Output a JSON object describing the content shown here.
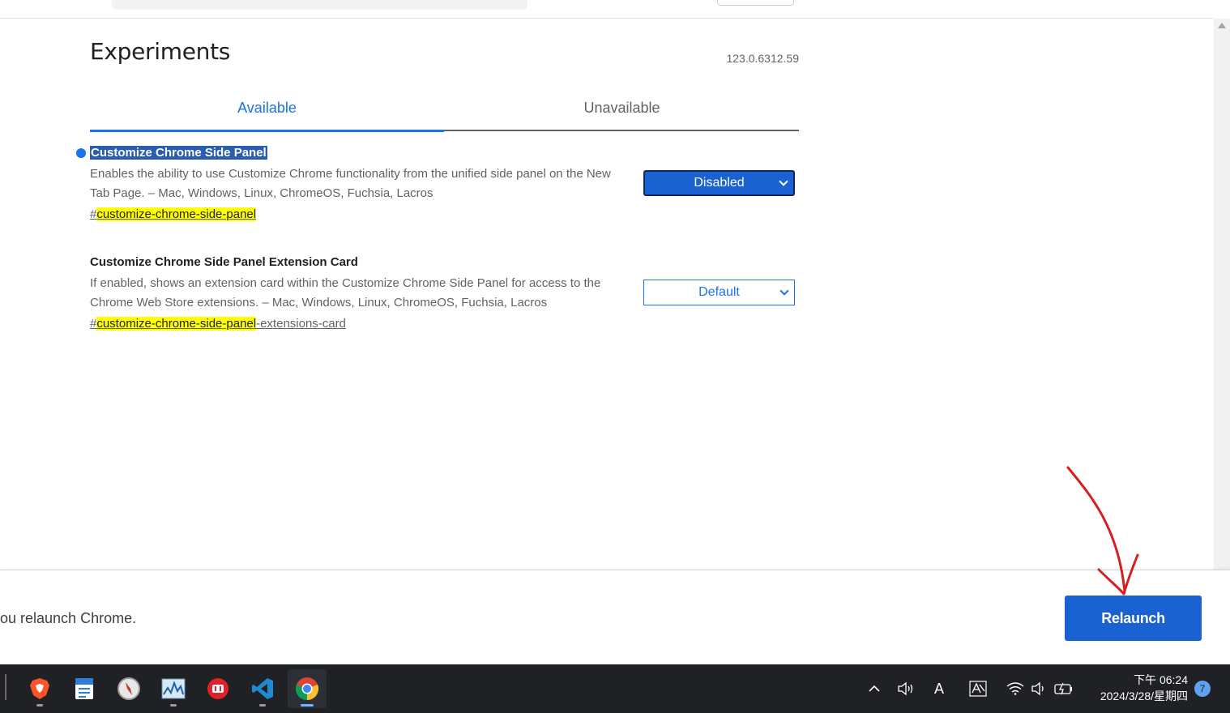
{
  "page": {
    "title": "Experiments",
    "version": "123.0.6312.59"
  },
  "tabs": [
    {
      "label": "Available",
      "active": true
    },
    {
      "label": "Unavailable",
      "active": false
    }
  ],
  "experiments": [
    {
      "title": "Customize Chrome Side Panel",
      "description": "Enables the ability to use Customize Chrome functionality from the unified side panel on the New Tab Page. – Mac, Windows, Linux, ChromeOS, Fuchsia, Lacros",
      "link_prefix": "#",
      "link_match": "customize-chrome-side-panel",
      "link_suffix": "",
      "select_value": "Disabled",
      "modified": true
    },
    {
      "title": "Customize Chrome Side Panel Extension Card",
      "description": "If enabled, shows an extension card within the Customize Chrome Side Panel for access to the Chrome Web Store extensions. – Mac, Windows, Linux, ChromeOS, Fuchsia, Lacros",
      "link_prefix": "#",
      "link_match": "customize-chrome-side-panel",
      "link_suffix": "-extensions-card",
      "select_value": "Default",
      "modified": false
    }
  ],
  "relaunch": {
    "message": "ou relaunch Chrome.",
    "button_label": "Relaunch"
  },
  "taskbar": {
    "apps": [
      "brave-icon",
      "document-editor-icon",
      "compass-icon",
      "system-monitor-icon",
      "red-app-icon",
      "vscode-icon",
      "chrome-icon"
    ],
    "active_app": "chrome-icon",
    "tray": {
      "ime_label": "A",
      "time": "下午 06:24",
      "date": "2024/3/28/星期四",
      "notification_count": "7"
    }
  },
  "colors": {
    "accent": "#1a73e8",
    "button": "#1a62d1",
    "highlight": "#ffff00",
    "annotation_arrow": "#d42020"
  }
}
